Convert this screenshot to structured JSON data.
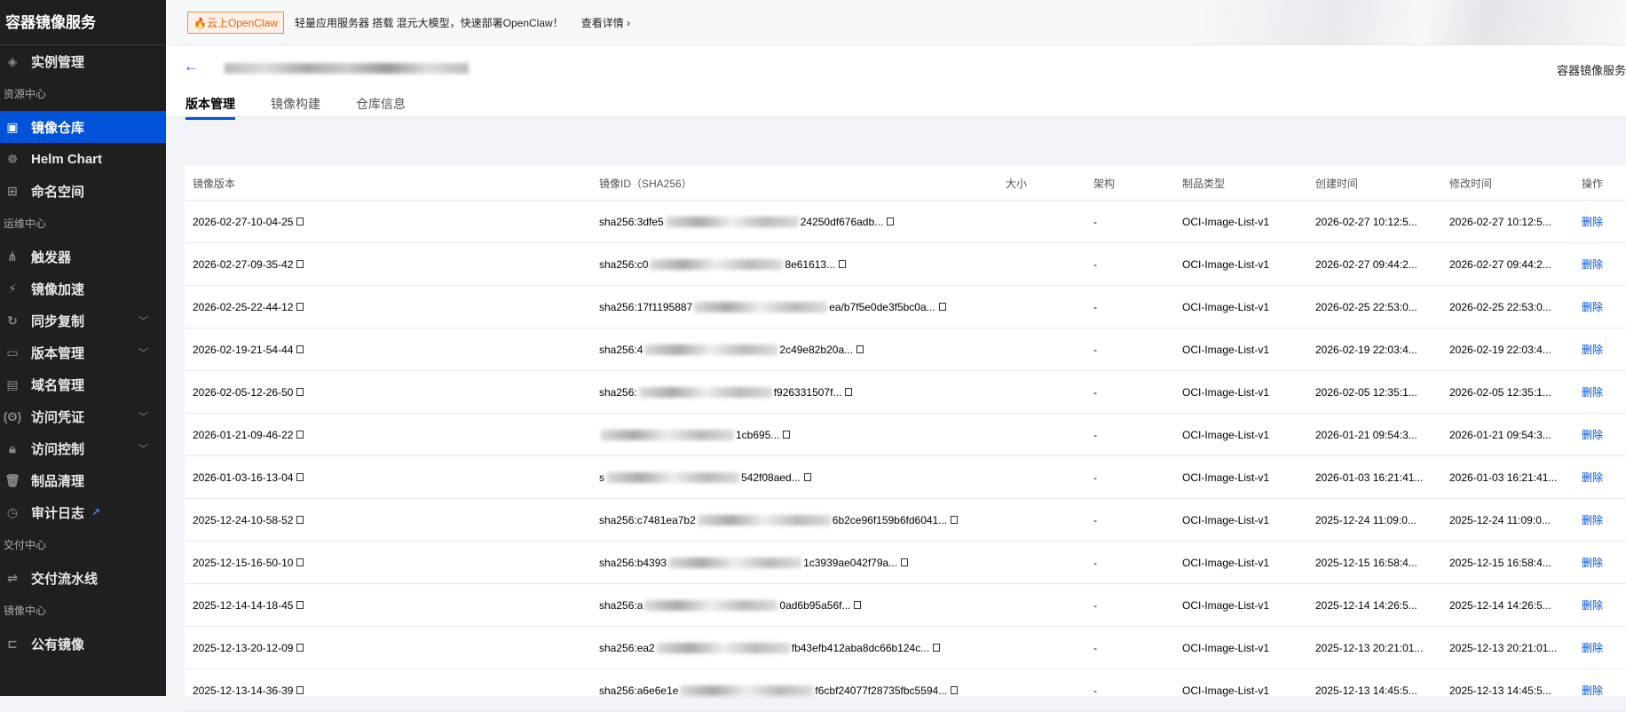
{
  "sidebar": {
    "title": "容器镜像服务",
    "items": [
      {
        "type": "item",
        "label": "实例管理",
        "icon": "layers-icon",
        "glyph": "◈"
      },
      {
        "type": "section",
        "label": "资源中心"
      },
      {
        "type": "item",
        "label": "镜像仓库",
        "icon": "repository-icon",
        "glyph": "▣",
        "active": true
      },
      {
        "type": "item",
        "label": "Helm Chart",
        "icon": "helm-icon",
        "glyph": "☸"
      },
      {
        "type": "item",
        "label": "命名空间",
        "icon": "namespace-icon",
        "glyph": "⊞"
      },
      {
        "type": "section",
        "label": "运维中心"
      },
      {
        "type": "item",
        "label": "触发器",
        "icon": "trigger-icon",
        "glyph": "⋔"
      },
      {
        "type": "item",
        "label": "镜像加速",
        "icon": "lightning-icon",
        "glyph": "⚡"
      },
      {
        "type": "item",
        "label": "同步复制",
        "icon": "sync-icon",
        "glyph": "↻",
        "chevron": true
      },
      {
        "type": "item",
        "label": "版本管理",
        "icon": "folder-icon",
        "glyph": "▭",
        "chevron": true
      },
      {
        "type": "item",
        "label": "域名管理",
        "icon": "window-icon",
        "glyph": "▤"
      },
      {
        "type": "item",
        "label": "访问凭证",
        "icon": "credential-icon",
        "glyph": "(ʘ)",
        "chevron": true
      },
      {
        "type": "item",
        "label": "访问控制",
        "icon": "lock-icon",
        "glyph": "🔒︎",
        "chevron": true
      },
      {
        "type": "item",
        "label": "制品清理",
        "icon": "trash-icon",
        "glyph": "🗑︎"
      },
      {
        "type": "item",
        "label": "审计日志",
        "icon": "history-icon",
        "glyph": "◷",
        "external": true
      },
      {
        "type": "section",
        "label": "交付中心"
      },
      {
        "type": "item",
        "label": "交付流水线",
        "icon": "pipeline-icon",
        "glyph": "⇌"
      },
      {
        "type": "section",
        "label": "镜像中心"
      },
      {
        "type": "item",
        "label": "公有镜像",
        "icon": "public-folder-icon",
        "glyph": "⊏"
      }
    ]
  },
  "topbar": {
    "badge": "🔥云上OpenClaw",
    "promo": "轻量应用服务器 搭载 混元大模型，快速部署OpenClaw！",
    "more": "查看详情 ›"
  },
  "header": {
    "service": "容器镜像服务",
    "tabs": [
      "版本管理",
      "镜像构建",
      "仓库信息"
    ]
  },
  "table": {
    "columns": [
      "镜像版本",
      "镜像ID（SHA256）",
      "大小",
      "架构",
      "制品类型",
      "创建时间",
      "修改时间",
      "操作"
    ],
    "rows": [
      {
        "tag": "2026-02-27-10-04-25",
        "id_start": "sha256:3dfe5",
        "id_end": "24250df676adb...",
        "arch": "-",
        "type": "OCI-Image-List-v1",
        "created": "2026-02-27 10:12:5...",
        "modified": "2026-02-27 10:12:5...",
        "action": "删除"
      },
      {
        "tag": "2026-02-27-09-35-42",
        "id_start": "sha256:c0",
        "id_end": "8e61613...",
        "arch": "-",
        "type": "OCI-Image-List-v1",
        "created": "2026-02-27 09:44:2...",
        "modified": "2026-02-27 09:44:2...",
        "action": "删除"
      },
      {
        "tag": "2026-02-25-22-44-12",
        "id_start": "sha256:17f1195887",
        "id_end": "ea/b7f5e0de3f5bc0a...",
        "arch": "-",
        "type": "OCI-Image-List-v1",
        "created": "2026-02-25 22:53:0...",
        "modified": "2026-02-25 22:53:0...",
        "action": "删除"
      },
      {
        "tag": "2026-02-19-21-54-44",
        "id_start": "sha256:4",
        "id_end": "2c49e82b20a...",
        "arch": "-",
        "type": "OCI-Image-List-v1",
        "created": "2026-02-19 22:03:4...",
        "modified": "2026-02-19 22:03:4...",
        "action": "删除"
      },
      {
        "tag": "2026-02-05-12-26-50",
        "id_start": "sha256:",
        "id_end": "f926331507f...",
        "arch": "-",
        "type": "OCI-Image-List-v1",
        "created": "2026-02-05 12:35:1...",
        "modified": "2026-02-05 12:35:1...",
        "action": "删除"
      },
      {
        "tag": "2026-01-21-09-46-22",
        "id_start": "",
        "id_end": "1cb695...",
        "arch": "-",
        "type": "OCI-Image-List-v1",
        "created": "2026-01-21 09:54:3...",
        "modified": "2026-01-21 09:54:3...",
        "action": "删除"
      },
      {
        "tag": "2026-01-03-16-13-04",
        "id_start": "s",
        "id_end": "542f08aed...",
        "arch": "-",
        "type": "OCI-Image-List-v1",
        "created": "2026-01-03 16:21:41...",
        "modified": "2026-01-03 16:21:41...",
        "action": "删除"
      },
      {
        "tag": "2025-12-24-10-58-52",
        "id_start": "sha256:c7481ea7b2",
        "id_end": "6b2ce96f159b6fd6041...",
        "arch": "-",
        "type": "OCI-Image-List-v1",
        "created": "2025-12-24 11:09:0...",
        "modified": "2025-12-24 11:09:0...",
        "action": "删除"
      },
      {
        "tag": "2025-12-15-16-50-10",
        "id_start": "sha256:b4393",
        "id_end": "1c3939ae042f79a...",
        "arch": "-",
        "type": "OCI-Image-List-v1",
        "created": "2025-12-15 16:58:4...",
        "modified": "2025-12-15 16:58:4...",
        "action": "删除"
      },
      {
        "tag": "2025-12-14-14-18-45",
        "id_start": "sha256:a",
        "id_end": "0ad6b95a56f...",
        "arch": "-",
        "type": "OCI-Image-List-v1",
        "created": "2025-12-14 14:26:5...",
        "modified": "2025-12-14 14:26:5...",
        "action": "删除"
      },
      {
        "tag": "2025-12-13-20-12-09",
        "id_start": "sha256:ea2",
        "id_end": "fb43efb412aba8dc66b124c...",
        "arch": "-",
        "type": "OCI-Image-List-v1",
        "created": "2025-12-13 20:21:01...",
        "modified": "2025-12-13 20:21:01...",
        "action": "删除"
      },
      {
        "tag": "2025-12-13-14-36-39",
        "id_start": "sha256:a6e6e1e",
        "id_end": "f6cbf24077f28735fbc5594...",
        "arch": "-",
        "type": "OCI-Image-List-v1",
        "created": "2025-12-13 14:45:5...",
        "modified": "2025-12-13 14:45:5...",
        "action": "删除"
      }
    ]
  }
}
